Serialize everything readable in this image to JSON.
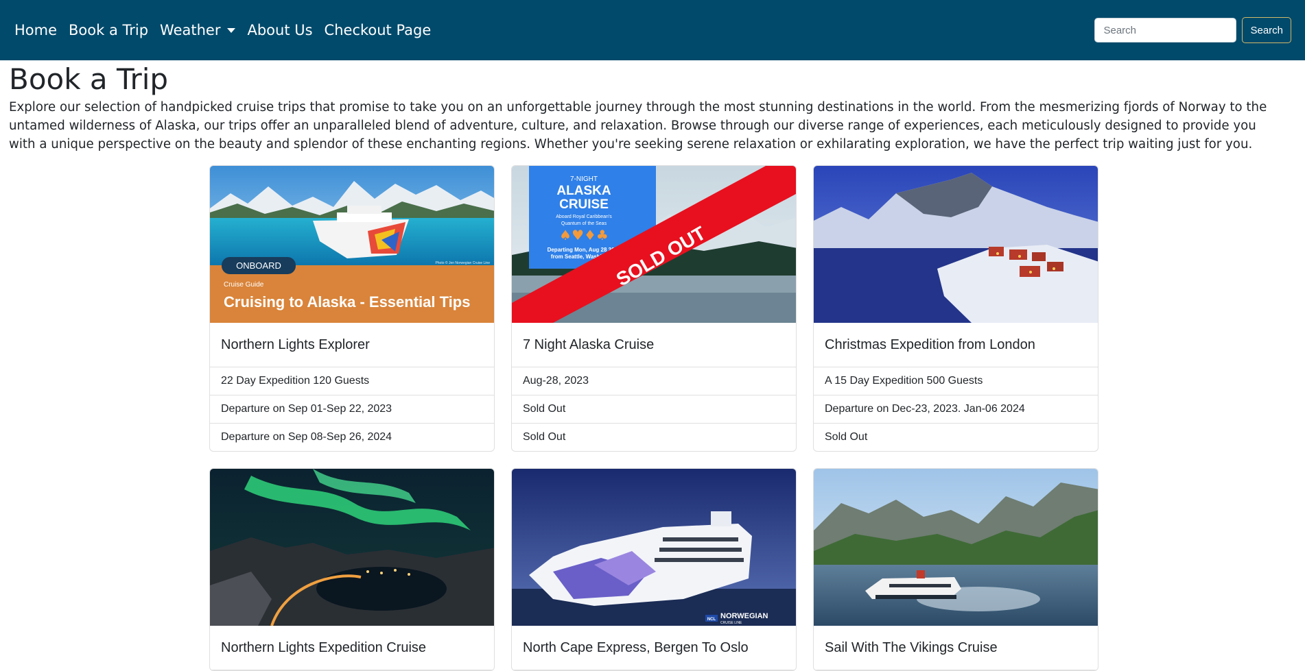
{
  "nav": {
    "links": [
      "Home",
      "Book a Trip",
      "Weather",
      "About Us",
      "Checkout Page"
    ],
    "search_placeholder": "Search",
    "search_button": "Search"
  },
  "page": {
    "title": "Book a Trip",
    "intro": "Explore our selection of handpicked cruise trips that promise to take you on an unforgettable journey through the most stunning destinations in the world. From the mesmerizing fjords of Norway to the untamed wilderness of Alaska, our trips offer an unparalleled blend of adventure, culture, and relaxation. Browse through our diverse range of experiences, each meticulously designed to provide you with a unique perspective on the beauty and splendor of these enchanting regions. Whether you're seeking serene relaxation or exhilarating exploration, we have the perfect trip waiting just for you."
  },
  "cards": [
    {
      "title": "Northern Lights Explorer",
      "items": [
        "22 Day Expedition 120 Guests",
        "Departure on Sep 01-Sep 22, 2023",
        "Departure on Sep 08-Sep 26, 2024"
      ],
      "image": {
        "badge": "ONBOARD",
        "kicker": "Cruise Guide",
        "headline": "Cruising to Alaska - Essential Tips",
        "credit": "Photo © Jen Norwegian Cruise Line"
      }
    },
    {
      "title": "7 Night Alaska Cruise",
      "items": [
        "Aug-28, 2023",
        "Sold Out",
        "Sold Out"
      ],
      "image": {
        "poster_top": "7-NIGHT",
        "poster_title_1": "ALASKA",
        "poster_title_2": "CRUISE",
        "poster_sub_1": "Aboard Royal Caribbean's",
        "poster_sub_2": "Quantum of the Seas",
        "poster_suits": "♠♥♦♣",
        "poster_depart_1": "Departing Mon, Aug 28 2023",
        "poster_depart_2": "from Seattle, Washington",
        "banner": "SOLD OUT"
      }
    },
    {
      "title": "Christmas Expedition from London",
      "items": [
        "A 15 Day Expedition 500 Guests",
        "Departure on Dec-23, 2023. Jan-06 2024",
        "Sold Out"
      ]
    },
    {
      "title": "Northern Lights Expedition Cruise"
    },
    {
      "title": "North Cape Express, Bergen To Oslo",
      "image": {
        "logo_badge": "NCL",
        "logo_name": "NORWEGIAN",
        "logo_sub": "CRUISE LINE"
      }
    },
    {
      "title": "Sail With The Vikings Cruise"
    }
  ]
}
